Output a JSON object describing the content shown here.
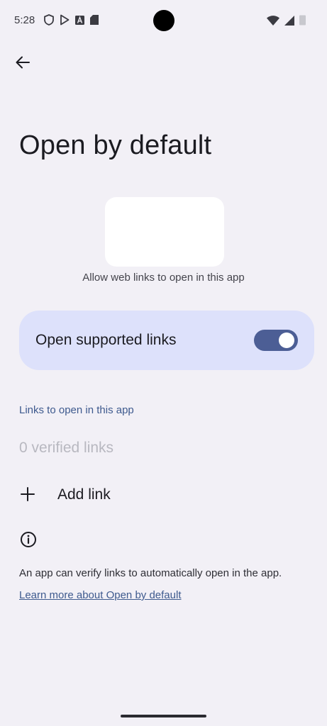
{
  "status_bar": {
    "time": "5:28",
    "left_icons": [
      "shield-icon",
      "play-store-icon",
      "font-icon",
      "sim-card-icon"
    ],
    "right_icons": [
      "wifi-icon",
      "cellular-signal-icon",
      "battery-icon"
    ]
  },
  "header": {
    "back_icon": "arrow-left-icon",
    "title": "Open by default"
  },
  "app": {
    "subtitle": "Allow web links to open in this app"
  },
  "toggle": {
    "label": "Open supported links",
    "checked": true
  },
  "links_section": {
    "header": "Links to open in this app",
    "verified_count_text": "0 verified links",
    "add_link_label": "Add link",
    "add_icon": "plus-icon"
  },
  "info": {
    "icon": "info-icon",
    "text": "An app can verify links to automatically open in the app.",
    "learn_more": "Learn more about Open by default"
  },
  "colors": {
    "background": "#f2f0f6",
    "card": "#dde1fb",
    "switch_track": "#4c5e95",
    "accent_text": "#3e5a8e"
  }
}
